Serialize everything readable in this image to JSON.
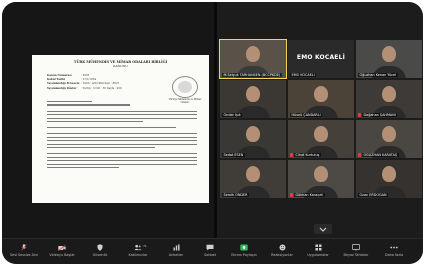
{
  "document": {
    "title": "TÜRK MÜHENDİS VE MİMAR ODALARI BİRLİĞİ",
    "subtitle": "KANUNU",
    "meta": [
      {
        "key": "Kanun Numarası",
        "value": ": 6235"
      },
      {
        "key": "Kabul Tarihi",
        "value": ": 27/1/1954"
      },
      {
        "key": "Yayımlandığı R.Gazete",
        "value": ": Tarih : 4/2/1954 Sayı : 8627"
      },
      {
        "key": "Yayımlandığı Düstur",
        "value": ": Tertip : 3 Cilt : 35 Sayfa : 200"
      }
    ],
    "logo_text": "Türkiye Mühendis ve Mimar Odaları"
  },
  "participants": [
    {
      "name": "M.Selçuk TARHANSEN (BCCPKDE)",
      "muted": false,
      "active": true
    },
    {
      "name": "EMO KOCAELİ",
      "muted": false,
      "active": false,
      "label": "EMO KOCAELİ"
    },
    {
      "name": "Oğuzhan Kenan Yücel",
      "muted": false,
      "active": false
    },
    {
      "name": "Önder Işık",
      "muted": false,
      "active": false
    },
    {
      "name": "Hüsnü ÇANDARLI",
      "muted": false,
      "active": false
    },
    {
      "name": "Dağahan ŞAHMANİ",
      "muted": true,
      "active": false
    },
    {
      "name": "Sedat ESEN",
      "muted": false,
      "active": false
    },
    {
      "name": "Cihat Kurtuluş",
      "muted": true,
      "active": false
    },
    {
      "name": "OĞUZHAN KARATAŞ",
      "muted": true,
      "active": false
    },
    {
      "name": "Semih ÖNDER",
      "muted": false,
      "active": false
    },
    {
      "name": "Gökhan Karaçeli",
      "muted": true,
      "active": false
    },
    {
      "name": "Ozan ERDOĞAN",
      "muted": false,
      "active": false
    }
  ],
  "toolbar": {
    "items": [
      {
        "label": "Sesi Sessize Alın",
        "icon": "microphone-icon",
        "color": "#e23b3b"
      },
      {
        "label": "Videoyu Başlat",
        "icon": "video-icon",
        "color": "#e23b3b"
      },
      {
        "label": "Güvenlik",
        "icon": "shield-icon",
        "color": "#cfcfcf"
      },
      {
        "label": "Katılımcılar",
        "icon": "participants-icon",
        "color": "#cfcfcf",
        "count": "71"
      },
      {
        "label": "Anketler",
        "icon": "poll-icon",
        "color": "#cfcfcf"
      },
      {
        "label": "Sohbet",
        "icon": "chat-icon",
        "color": "#cfcfcf"
      },
      {
        "label": "Ekranı Paylaşın",
        "icon": "share-screen-icon",
        "color": "#2eb85c"
      },
      {
        "label": "Reaksiyonlar",
        "icon": "reactions-icon",
        "color": "#cfcfcf"
      },
      {
        "label": "Uygulamalar",
        "icon": "apps-icon",
        "color": "#cfcfcf"
      },
      {
        "label": "Beyaz Tahtalar",
        "icon": "whiteboard-icon",
        "color": "#cfcfcf"
      },
      {
        "label": "Daha fazla",
        "icon": "more-icon",
        "color": "#cfcfcf"
      }
    ]
  }
}
